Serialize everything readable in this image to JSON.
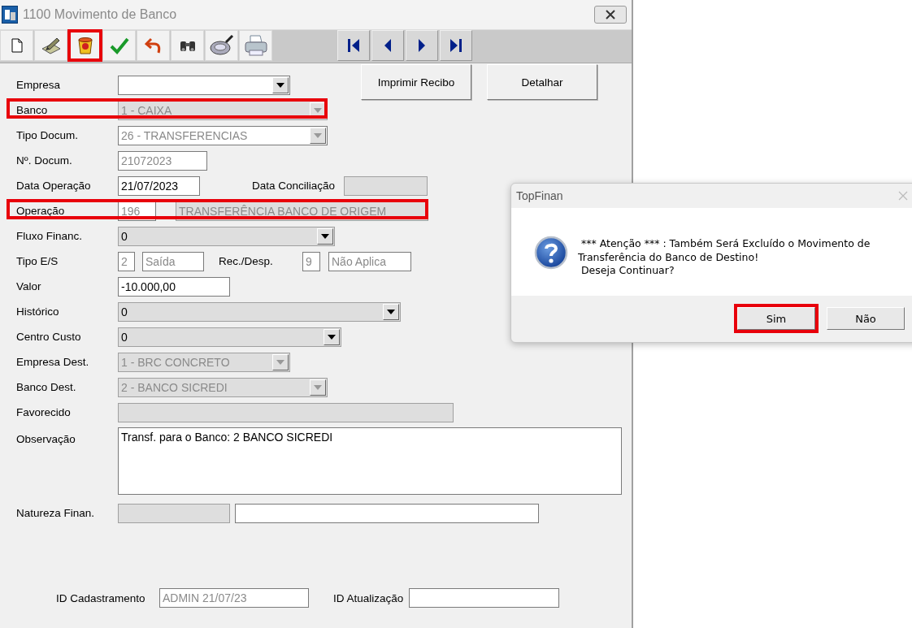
{
  "window": {
    "title": "1100 Movimento de Banco"
  },
  "toolbar": [
    {
      "kind": "new",
      "highlighted": false
    },
    {
      "kind": "edit",
      "highlighted": false
    },
    {
      "kind": "delete",
      "highlighted": true
    },
    {
      "kind": "confirm",
      "highlighted": false
    },
    {
      "kind": "undo",
      "highlighted": false
    },
    {
      "kind": "find",
      "highlighted": false
    },
    {
      "kind": "disc",
      "highlighted": false
    },
    {
      "kind": "print",
      "highlighted": false
    }
  ],
  "navigation": [
    {
      "kind": "first"
    },
    {
      "kind": "previous"
    },
    {
      "kind": "next"
    },
    {
      "kind": "last"
    }
  ],
  "buttons": [
    {
      "label": "Imprimir Recibo"
    },
    {
      "label": "Detalhar"
    }
  ],
  "rows": [
    {
      "label": "Empresa",
      "highlighted": false,
      "fields": [
        {
          "kind": "combo",
          "disabled": false
        }
      ]
    },
    {
      "label": "Banco",
      "highlighted": true,
      "fields": [
        {
          "kind": "list",
          "value": "1 - CAIXA",
          "disabled": true
        }
      ]
    },
    {
      "label": "Tipo Docum.",
      "highlighted": false,
      "fields": [
        {
          "kind": "combo",
          "value": "26 - TRANSFERENCIAS",
          "disabled": true
        }
      ]
    },
    {
      "label": "Nº. Docum.",
      "highlighted": false,
      "fields": [
        {
          "kind": "text",
          "value": "21072023",
          "disabled": true
        }
      ]
    },
    {
      "label": "Data Operação",
      "highlighted": false,
      "fields": [
        {
          "kind": "text",
          "value": "21/07/2023",
          "disabled": false
        },
        {
          "kind": "caption",
          "text": "Data Conciliação"
        },
        {
          "kind": "readonly"
        }
      ]
    },
    {
      "label": "Operação",
      "highlighted": true,
      "fields": [
        {
          "kind": "text",
          "value": "196",
          "disabled": true
        },
        {
          "kind": "readonly",
          "value": "TRANSFERÊNCIA BANCO DE ORIGEM",
          "disabled": true
        }
      ]
    },
    {
      "label": "Fluxo Financ.",
      "highlighted": false,
      "fields": [
        {
          "kind": "list",
          "value": "0",
          "disabled": false
        }
      ]
    },
    {
      "label": "Tipo E/S",
      "highlighted": false,
      "fields": [
        {
          "kind": "text",
          "value": "2",
          "disabled": true
        },
        {
          "kind": "text",
          "value": "Saída",
          "disabled": true
        },
        {
          "kind": "caption",
          "text": "Rec./Desp."
        },
        {
          "kind": "text",
          "value": "9",
          "disabled": true
        },
        {
          "kind": "text",
          "value": "Não Aplica",
          "disabled": true
        }
      ]
    },
    {
      "label": "Valor",
      "highlighted": false,
      "fields": [
        {
          "kind": "text",
          "value": "-10.000,00",
          "disabled": false
        }
      ]
    },
    {
      "label": "Histórico",
      "highlighted": false,
      "fields": [
        {
          "kind": "list",
          "value": "0",
          "disabled": false
        }
      ]
    },
    {
      "label": "Centro Custo",
      "highlighted": false,
      "fields": [
        {
          "kind": "list",
          "value": "0",
          "disabled": false
        }
      ]
    },
    {
      "label": "Empresa Dest.",
      "highlighted": false,
      "fields": [
        {
          "kind": "list",
          "value": "1 - BRC CONCRETO",
          "disabled": true
        }
      ]
    },
    {
      "label": "Banco Dest.",
      "highlighted": false,
      "fields": [
        {
          "kind": "list",
          "value": "2 - BANCO SICREDI",
          "disabled": true
        }
      ]
    },
    {
      "label": "Favorecido",
      "highlighted": false,
      "fields": [
        {
          "kind": "readonly"
        }
      ]
    },
    {
      "label": "Observação",
      "highlighted": false,
      "fields": [
        {
          "kind": "memo",
          "value": "Transf. para o Banco: 2 BANCO SICREDI",
          "disabled": false
        }
      ]
    },
    {
      "label": "Natureza Finan.",
      "highlighted": false,
      "fields": [
        {
          "kind": "readonly"
        },
        {
          "kind": "text"
        }
      ]
    }
  ],
  "footer": [
    {
      "label": "ID Cadastramento",
      "value": "ADMIN 21/07/23",
      "disabled": true
    },
    {
      "label": "ID Atualização"
    }
  ],
  "dialog": {
    "title": "TopFinan",
    "message": [
      " *** Atenção *** : Também Será Excluído o Movimento de",
      "Transferência do Banco de Destino!",
      " Deseja Continuar?"
    ],
    "buttons": [
      {
        "label": "Sim",
        "highlighted": true
      },
      {
        "label": "Não",
        "highlighted": false
      }
    ]
  }
}
